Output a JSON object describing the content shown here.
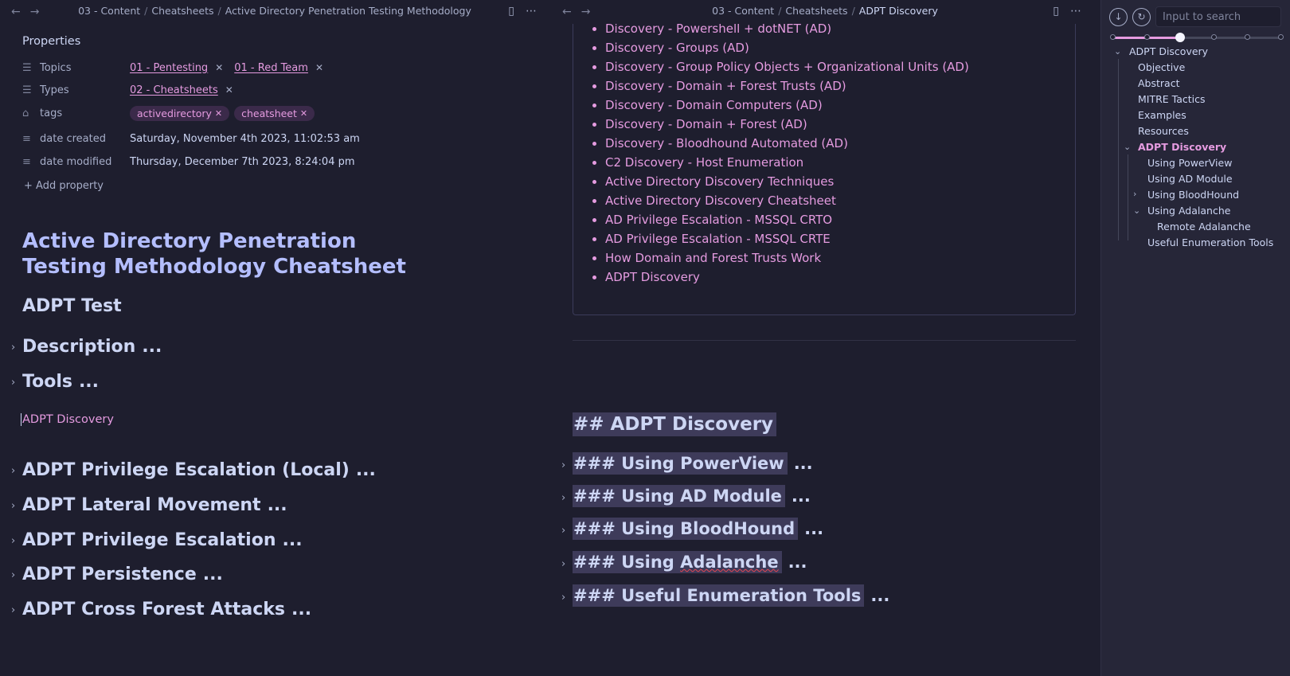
{
  "left": {
    "breadcrumb": [
      "03 - Content",
      "Cheatsheets",
      "Active Directory Penetration Testing Methodology"
    ],
    "properties_title": "Properties",
    "properties": {
      "topics": {
        "name": "Topics",
        "values": [
          "01 - Pentesting",
          "01 - Red Team"
        ]
      },
      "types": {
        "name": "Types",
        "values": [
          "02 - Cheatsheets"
        ]
      },
      "tags": {
        "name": "tags",
        "values": [
          "activedirectory",
          "cheatsheet"
        ]
      },
      "created": {
        "name": "date created",
        "value": "Saturday, November 4th 2023, 11:02:53 am"
      },
      "modified": {
        "name": "date modified",
        "value": "Thursday, December 7th 2023, 8:24:04 pm"
      }
    },
    "add_property": "Add property",
    "title": "Active Directory Penetration Testing Methodology Cheatsheet",
    "subtitle": "ADPT Test",
    "sections_top": [
      "Description",
      "Tools"
    ],
    "embed_link": "ADPT Discovery",
    "sections_bottom": [
      "ADPT Privilege Escalation (Local)",
      "ADPT Lateral Movement",
      "ADPT Privilege Escalation",
      "ADPT Persistence",
      "ADPT Cross Forest Attacks"
    ],
    "ellipsis": "..."
  },
  "right": {
    "breadcrumb": [
      "03 - Content",
      "Cheatsheets",
      "ADPT Discovery"
    ],
    "embed_list": [
      "Discovery - Powershell + dotNET (AD)",
      "Discovery - Groups (AD)",
      "Discovery - Group Policy Objects + Organizational Units (AD)",
      "Discovery - Domain + Forest Trusts (AD)",
      "Discovery - Domain Computers (AD)",
      "Discovery - Domain + Forest (AD)",
      "Discovery - Bloodhound Automated (AD)",
      "C2 Discovery - Host Enumeration",
      "Active Directory Discovery Techniques",
      "Active Directory Discovery Cheatsheet",
      "AD Privilege Escalation - MSSQL CRTO",
      "AD Privilege Escalation - MSSQL CRTE",
      "How Domain and Forest Trusts Work",
      "ADPT Discovery"
    ],
    "h2_source": "## ADPT Discovery",
    "h3_sources": [
      "### Using PowerView",
      "### Using AD Module",
      "### Using BloodHound",
      "### Using ",
      "### Useful Enumeration Tools"
    ],
    "adalanche_word": "Adalanche",
    "ellipsis": "..."
  },
  "sidebar": {
    "search_placeholder": "Input to search",
    "outline_level": 0.4,
    "outline": {
      "root": "ADPT Discovery",
      "objective": "Objective",
      "abstract": "Abstract",
      "mitre": "MITRE Tactics",
      "examples": "Examples",
      "resources": "Resources",
      "adpt": "ADPT Discovery",
      "powerview": "Using PowerView",
      "admodule": "Using AD Module",
      "bloodhound": "Using BloodHound",
      "adalanche": "Using Adalanche",
      "remote_adalanche": "Remote Adalanche",
      "useful": "Useful Enumeration Tools"
    }
  },
  "colors": {
    "accent": "#e59be0",
    "heading": "#b4befe",
    "background": "#1e1e2e"
  },
  "icons": {
    "back": "arrow-left-icon",
    "forward": "arrow-right-icon",
    "reading": "book-icon",
    "more": "more-icon"
  }
}
